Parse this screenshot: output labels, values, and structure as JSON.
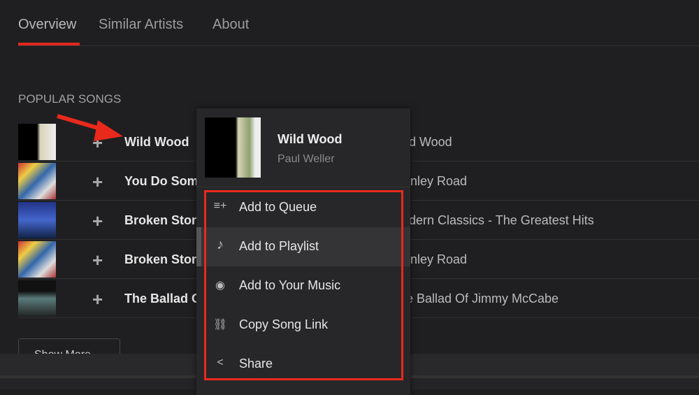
{
  "tabs": [
    {
      "label": "Overview",
      "active": true
    },
    {
      "label": "Similar Artists"
    },
    {
      "label": "About"
    }
  ],
  "section_title": "POPULAR SONGS",
  "songs": [
    {
      "title": "Wild Wood",
      "album": "Wild Wood"
    },
    {
      "title": "You Do Something To Me",
      "album": "Stanley Road"
    },
    {
      "title": "Broken Stones",
      "album": "Modern Classics - The Greatest Hits"
    },
    {
      "title": "Broken Stones",
      "album": "Stanley Road"
    },
    {
      "title": "The Ballad Of Jimmy McCabe",
      "album": "The Ballad Of Jimmy McCabe"
    }
  ],
  "show_more": "Show More",
  "context_menu": {
    "song_title": "Wild Wood",
    "artist": "Paul Weller",
    "items": [
      {
        "label": "Add to Queue",
        "icon": "queue-add-icon"
      },
      {
        "label": "Add to Playlist",
        "icon": "music-note-icon"
      },
      {
        "label": "Add to Your Music",
        "icon": "disc-icon"
      },
      {
        "label": "Copy Song Link",
        "icon": "link-icon"
      },
      {
        "label": "Share",
        "icon": "share-icon"
      }
    ]
  },
  "colors": {
    "accent": "#e0281e",
    "annotation": "#e8291c"
  }
}
